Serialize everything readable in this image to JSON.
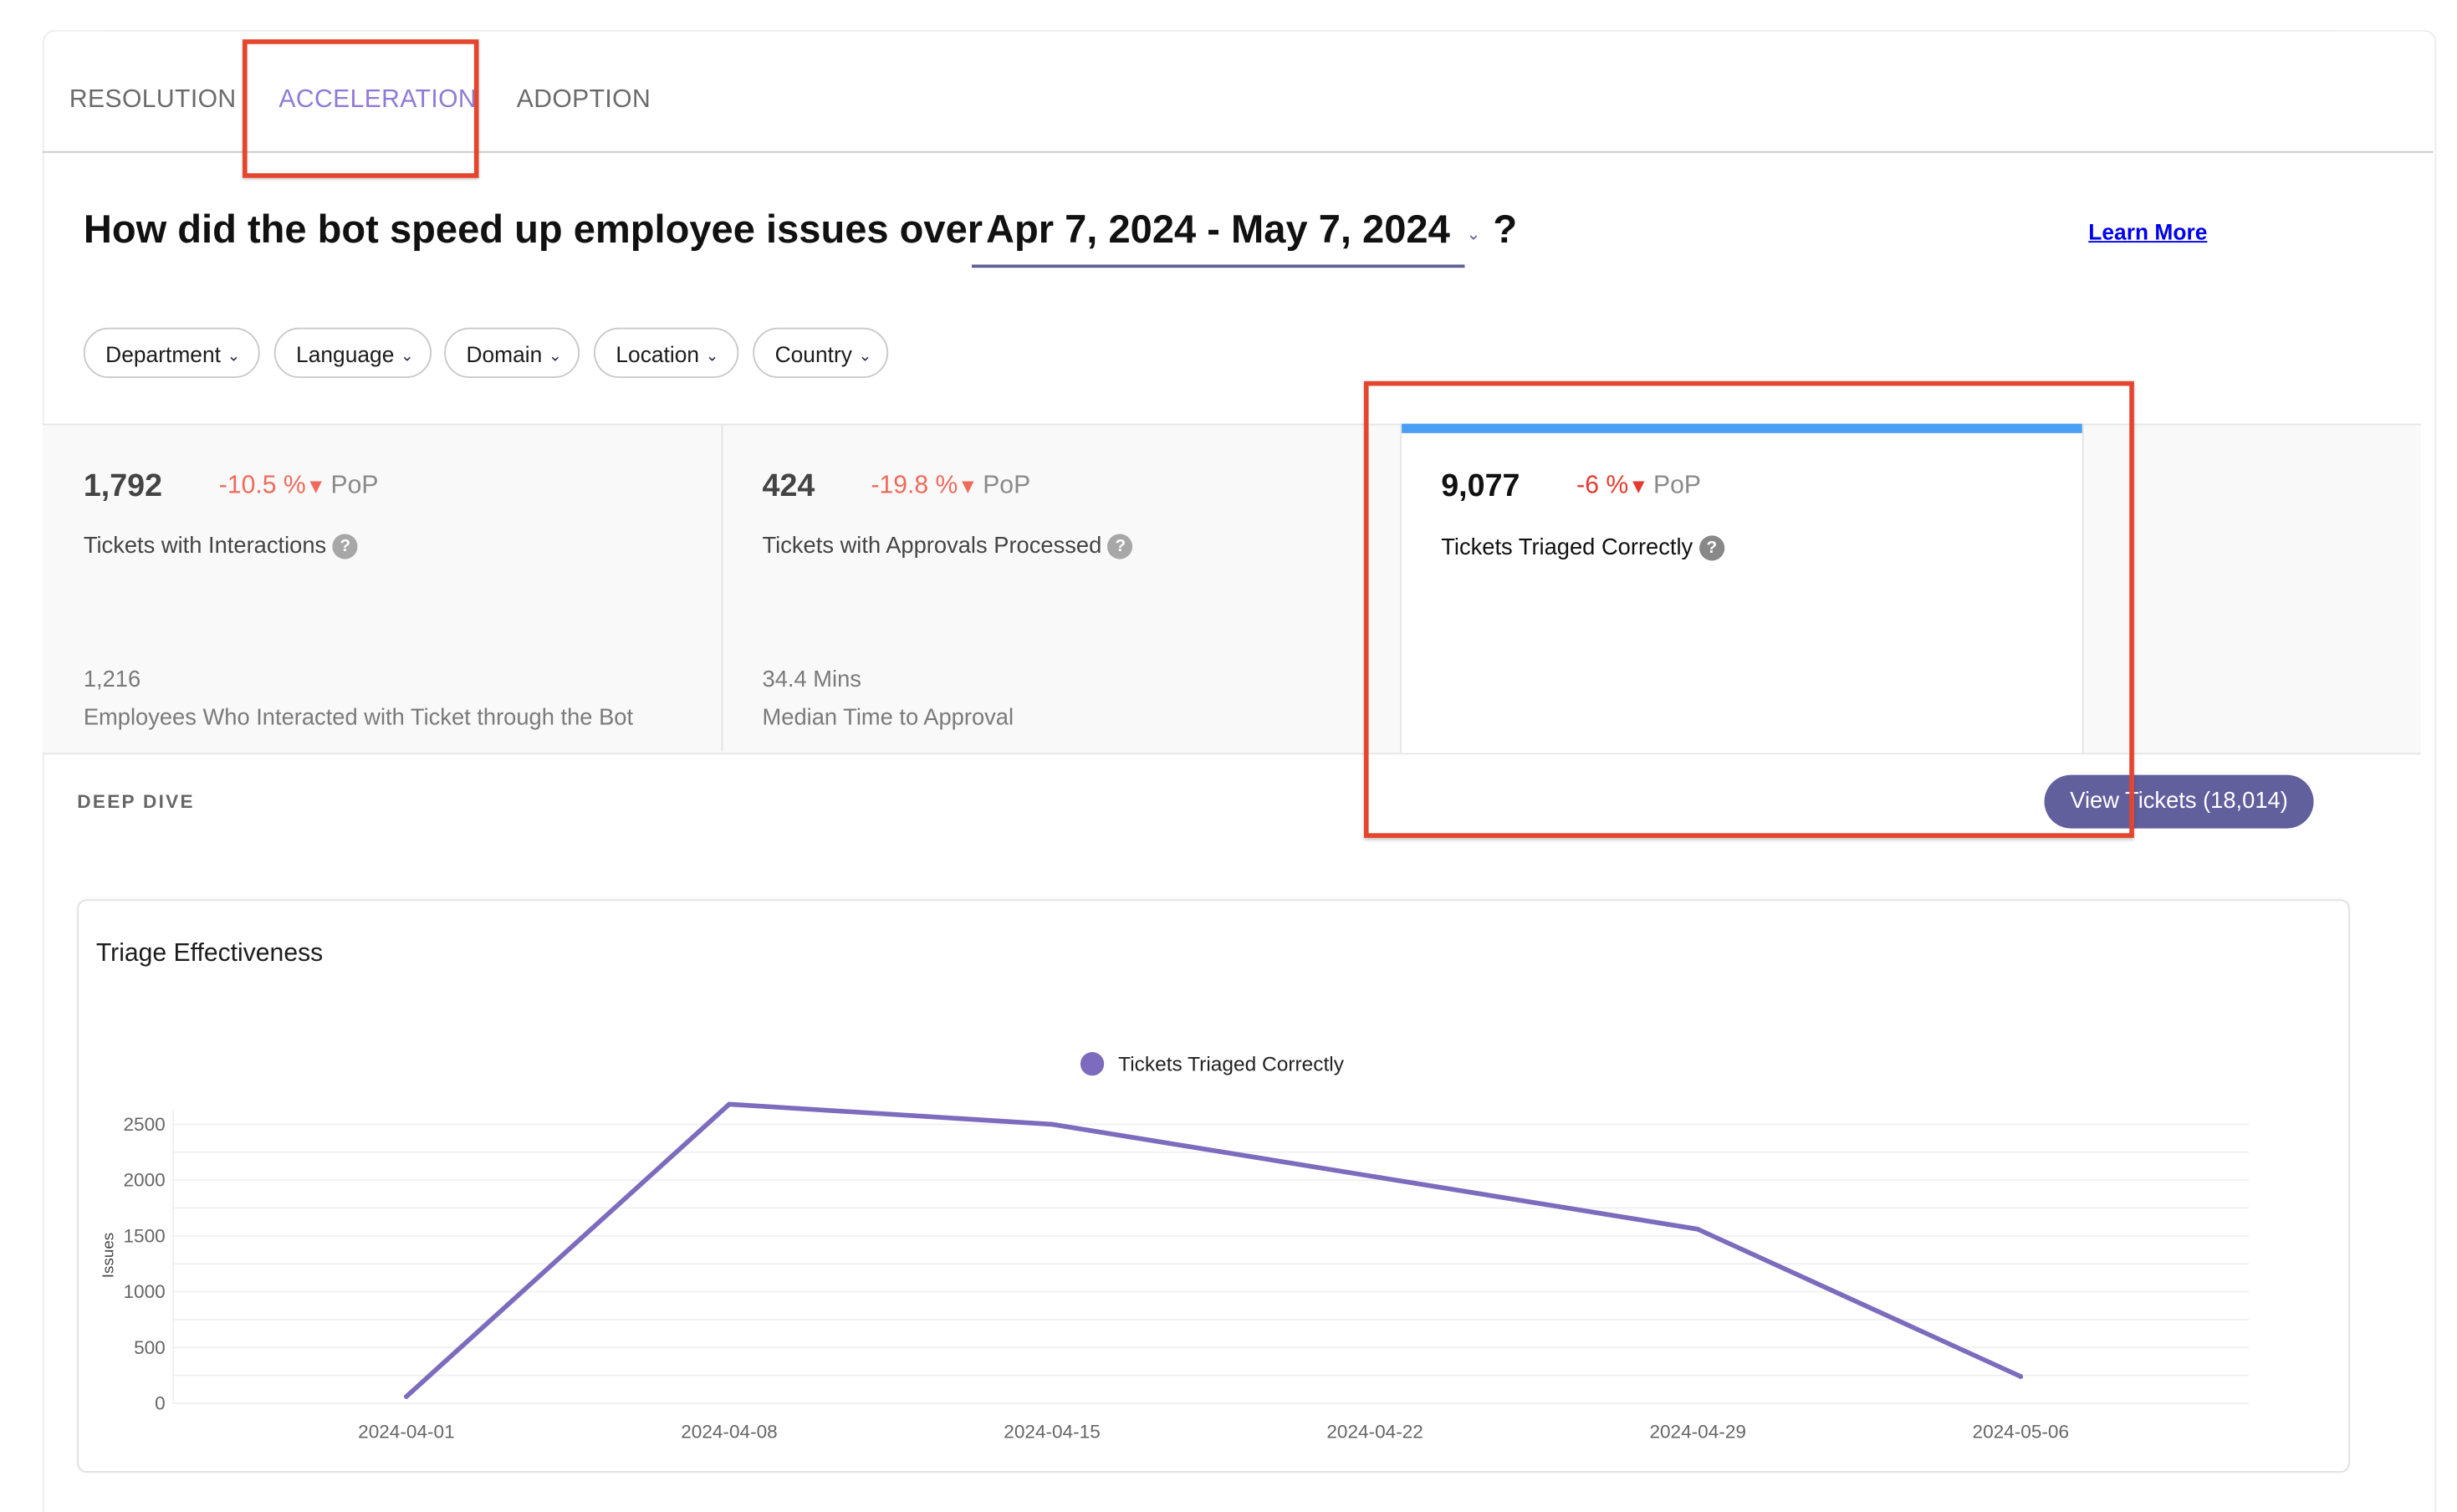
{
  "tabs": [
    {
      "label": "RESOLUTION",
      "active": false
    },
    {
      "label": "ACCELERATION",
      "active": true
    },
    {
      "label": "ADOPTION",
      "active": false
    }
  ],
  "header": {
    "question_prefix": "How did the bot speed up employee issues over",
    "date_range": "Apr 7, 2024 - May 7, 2024",
    "question_suffix": "?",
    "learn_more": "Learn More"
  },
  "filters": [
    "Department",
    "Language",
    "Domain",
    "Location",
    "Country"
  ],
  "kpis": [
    {
      "value": "1,792",
      "change": "-10.5 %",
      "change_suffix": "PoP",
      "label": "Tickets with Interactions",
      "sub_value": "1,216",
      "sub_label": "Employees Who Interacted with Ticket through the Bot",
      "selected": false
    },
    {
      "value": "424",
      "change": "-19.8 %",
      "change_suffix": "PoP",
      "label": "Tickets with Approvals Processed",
      "sub_value": "34.4 Mins",
      "sub_label": "Median Time to Approval",
      "selected": false
    },
    {
      "value": "9,077",
      "change": "-6 %",
      "change_suffix": "PoP",
      "label": "Tickets Triaged Correctly",
      "sub_value": "",
      "sub_label": "",
      "selected": true
    }
  ],
  "deep_dive": {
    "label": "DEEP DIVE",
    "view_tickets": "View Tickets (18,014)"
  },
  "colors": {
    "accent": "#8f7bd6",
    "series": "#7d6bbd",
    "negative": "#ee6b5c",
    "selected_bar": "#4a9ff5",
    "button": "#625f9d",
    "annotation": "#e4452d"
  },
  "chart_data": {
    "type": "line",
    "title": "Triage Effectiveness",
    "xlabel": "",
    "ylabel": "Issues",
    "x": [
      "2024-04-01",
      "2024-04-08",
      "2024-04-15",
      "2024-04-22",
      "2024-04-29",
      "2024-05-06"
    ],
    "series": [
      {
        "name": "Tickets Triaged Correctly",
        "values": [
          60,
          2680,
          2500,
          2030,
          1560,
          240
        ]
      }
    ],
    "yticks": [
      0,
      500,
      1000,
      1500,
      2000,
      2500
    ],
    "ylim": [
      0,
      2625
    ],
    "grid": true,
    "legend": "top-center"
  }
}
